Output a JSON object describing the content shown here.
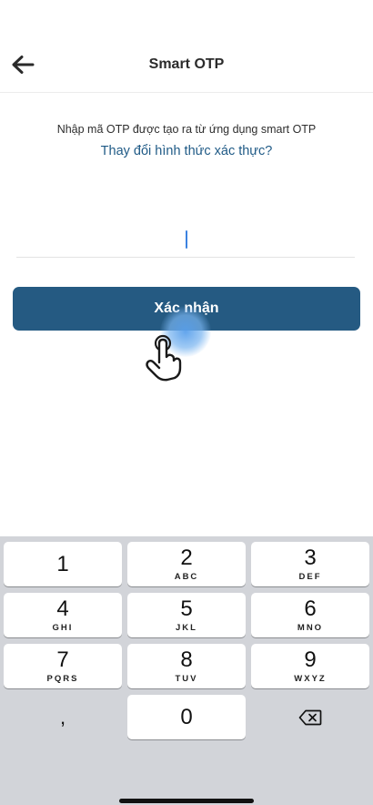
{
  "header": {
    "title": "Smart OTP",
    "back_icon": "arrow-left-icon"
  },
  "content": {
    "instruction": "Nhập mã OTP được tạo ra từ ứng dụng smart OTP",
    "change_link": "Thay đổi hình thức xác thực?",
    "otp_value": "",
    "confirm_label": "Xác nhận"
  },
  "colors": {
    "primary": "#255a82",
    "link": "#1f5a86",
    "keyboard_bg": "#d2d4d9"
  },
  "keyboard": {
    "keys": [
      {
        "digit": "1",
        "letters": ""
      },
      {
        "digit": "2",
        "letters": "ABC"
      },
      {
        "digit": "3",
        "letters": "DEF"
      },
      {
        "digit": "4",
        "letters": "GHI"
      },
      {
        "digit": "5",
        "letters": "JKL"
      },
      {
        "digit": "6",
        "letters": "MNO"
      },
      {
        "digit": "7",
        "letters": "PQRS"
      },
      {
        "digit": "8",
        "letters": "TUV"
      },
      {
        "digit": "9",
        "letters": "WXYZ"
      },
      {
        "digit": ",",
        "letters": ""
      },
      {
        "digit": "0",
        "letters": ""
      }
    ],
    "delete_icon": "backspace-icon"
  }
}
